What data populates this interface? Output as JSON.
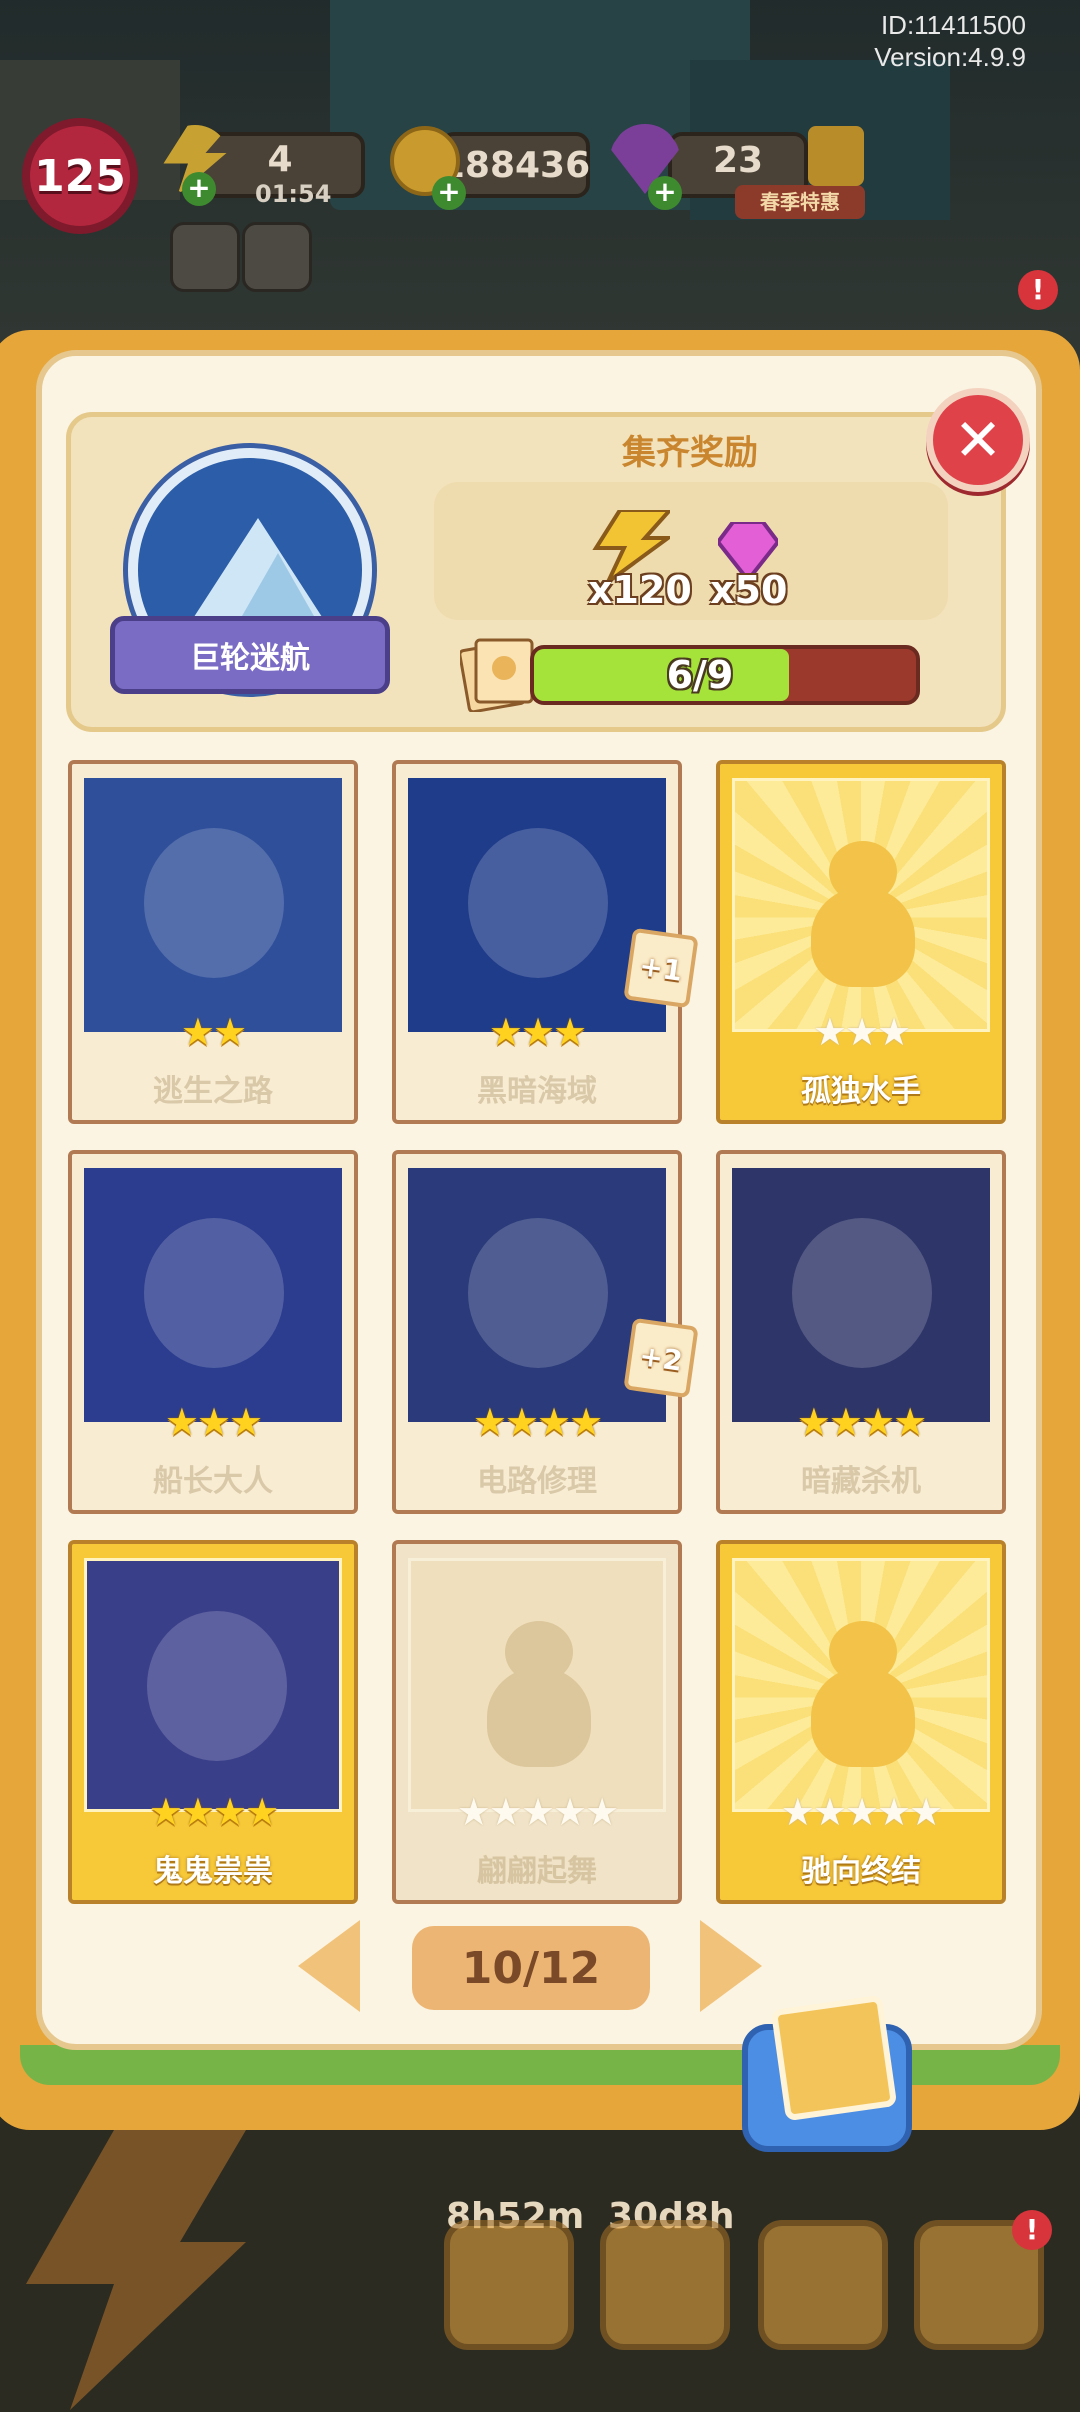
{
  "debug": {
    "id": "ID:11411500",
    "version": "Version:4.9.9"
  },
  "hud": {
    "level": "125",
    "energy": "4",
    "energy_timer": "01:54",
    "coins": "188436",
    "gems": "23",
    "event_label": "春季特惠"
  },
  "collection": {
    "name": "巨轮迷航",
    "reward_title": "集齐奖励",
    "rewards": [
      {
        "icon": "lightning-icon",
        "amount": "x120"
      },
      {
        "icon": "gem-icon",
        "amount": "x50"
      }
    ],
    "progress_text": "6/9",
    "progress_fraction": 0.667
  },
  "cards": [
    {
      "name": "逃生之路",
      "stars": 2,
      "max_stars": 2,
      "state": "owned",
      "extra": ""
    },
    {
      "name": "黑暗海域",
      "stars": 3,
      "max_stars": 3,
      "state": "owned",
      "extra": "+1"
    },
    {
      "name": "孤独水手",
      "stars": 0,
      "max_stars": 3,
      "state": "gold-missing",
      "extra": ""
    },
    {
      "name": "船长大人",
      "stars": 3,
      "max_stars": 3,
      "state": "owned",
      "extra": ""
    },
    {
      "name": "电路修理",
      "stars": 4,
      "max_stars": 4,
      "state": "owned",
      "extra": "+2"
    },
    {
      "name": "暗藏杀机",
      "stars": 4,
      "max_stars": 4,
      "state": "owned",
      "extra": ""
    },
    {
      "name": "鬼鬼祟祟",
      "stars": 4,
      "max_stars": 4,
      "state": "gold-owned",
      "extra": ""
    },
    {
      "name": "翩翩起舞",
      "stars": 0,
      "max_stars": 5,
      "state": "missing",
      "extra": ""
    },
    {
      "name": "驰向终结",
      "stars": 0,
      "max_stars": 5,
      "state": "gold-missing",
      "extra": ""
    }
  ],
  "pagination": {
    "label": "10/12"
  },
  "bottom": {
    "timer_left": "8h52m",
    "timer_right": "30d8h",
    "badge": "!"
  },
  "colors": {
    "gold_card": "#f7c939",
    "progress_fill": "#a5e33a",
    "close": "#e0424a"
  }
}
